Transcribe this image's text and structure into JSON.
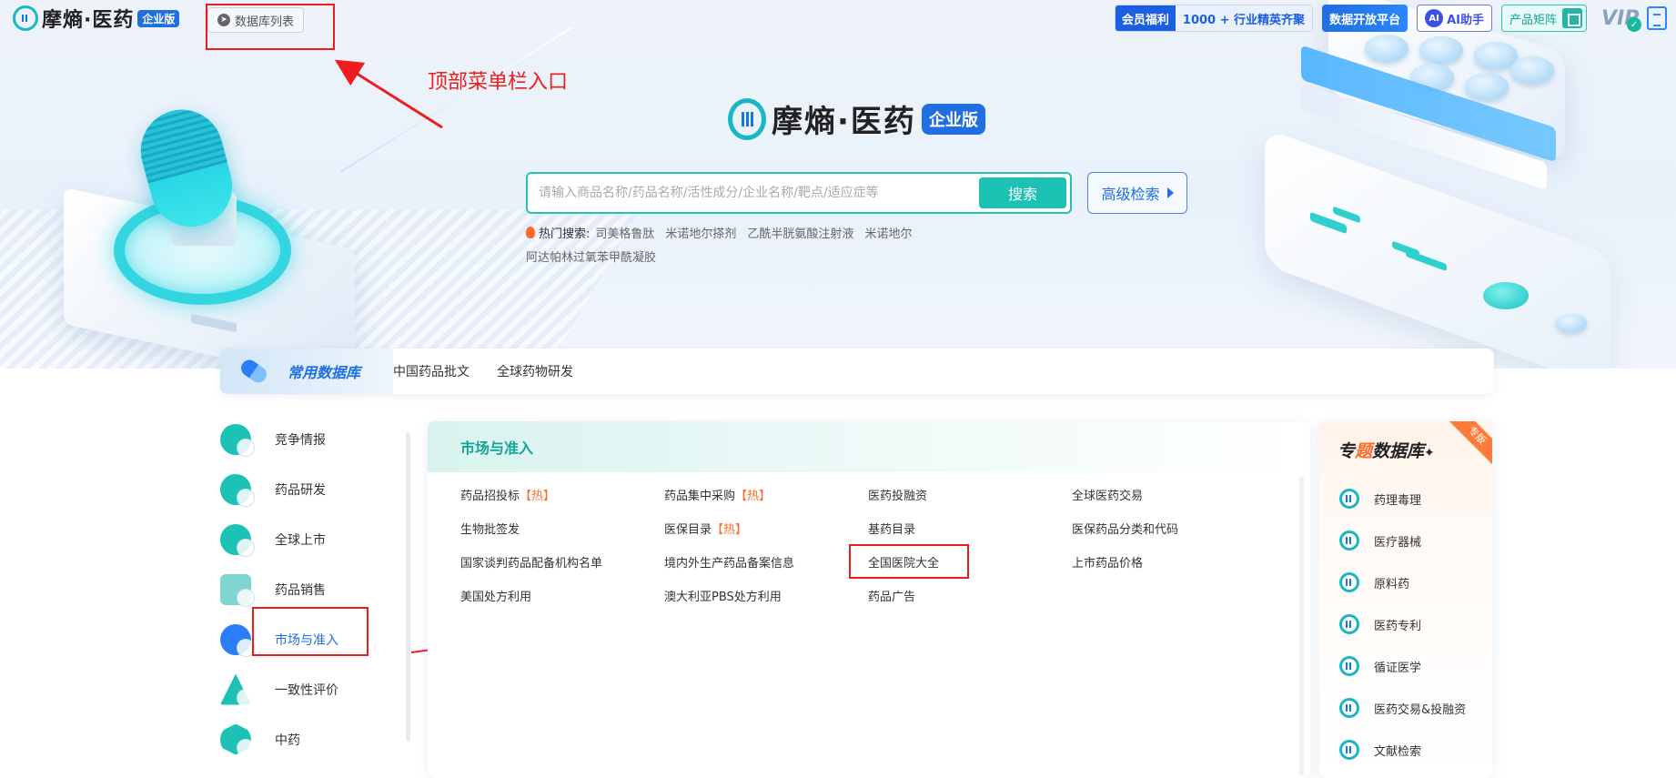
{
  "topbar": {
    "logo_text": "摩熵·医药",
    "logo_badge": "企业版",
    "db_list_button": "数据库列表",
    "welfare_label": "会员福利",
    "welfare_value": "1000 + 行业精英齐聚",
    "open_platform": "数据开放平台",
    "ai_badge": "AI",
    "ai_helper": "AI助手",
    "product_matrix": "产品矩阵",
    "vip_text": "VIP"
  },
  "annotation": {
    "top_menu_entry": "顶部菜单栏入口"
  },
  "brand": {
    "name": "摩熵·医药",
    "badge": "企业版"
  },
  "search": {
    "placeholder": "请输入商品名称/药品名称/活性成分/企业名称/靶点/适应症等",
    "button": "搜索",
    "advanced": "高级检索"
  },
  "hot_search": {
    "label": "热门搜索:",
    "keywords": [
      "司美格鲁肽",
      "米诺地尔搽剂",
      "乙酰半胱氨酸注射液",
      "米诺地尔",
      "阿达帕林过氧苯甲酰凝胶"
    ]
  },
  "common_db": {
    "title": "常用数据库",
    "links": [
      "中国药品批文",
      "全球药物研发"
    ]
  },
  "left_nav": {
    "items": [
      {
        "label": "竞争情报",
        "color": "#1cc2b3"
      },
      {
        "label": "药品研发",
        "color": "#1cc2b3"
      },
      {
        "label": "全球上市",
        "color": "#1cc2b3"
      },
      {
        "label": "药品销售",
        "color": "#1cc2b3"
      },
      {
        "label": "市场与准入",
        "color": "#2b7ef7"
      },
      {
        "label": "一致性评价",
        "color": "#1cc2b3"
      },
      {
        "label": "中药",
        "color": "#1cc2b3"
      }
    ],
    "active_index": 4
  },
  "panel": {
    "title": "市场与准入",
    "hot_tag": "【热】",
    "rows": [
      [
        "药品招投标",
        "药品集中采购",
        "医药投融资",
        "全球医药交易"
      ],
      [
        "生物批签发",
        "医保目录",
        "基药目录",
        "医保药品分类和代码"
      ],
      [
        "国家谈判药品配备机构名单",
        "境内外生产药品备案信息",
        "全国医院大全",
        "上市药品价格"
      ],
      [
        "美国处方利用",
        "澳大利亚PBS处方利用",
        "药品广告",
        ""
      ]
    ]
  },
  "special_db": {
    "title_pre": "专",
    "title_hl": "题",
    "title_post": "数据库",
    "spark": "✦",
    "corner_tag": "专版",
    "items": [
      "药理毒理",
      "医疗器械",
      "原料药",
      "医药专利",
      "循证医学",
      "医药交易&投融资",
      "文献检索"
    ]
  },
  "colors": {
    "brand_blue": "#1f6fe0",
    "teal": "#1cc2b3",
    "annotation_red": "#ee1d1d",
    "hot_orange": "#ff6a2b"
  }
}
